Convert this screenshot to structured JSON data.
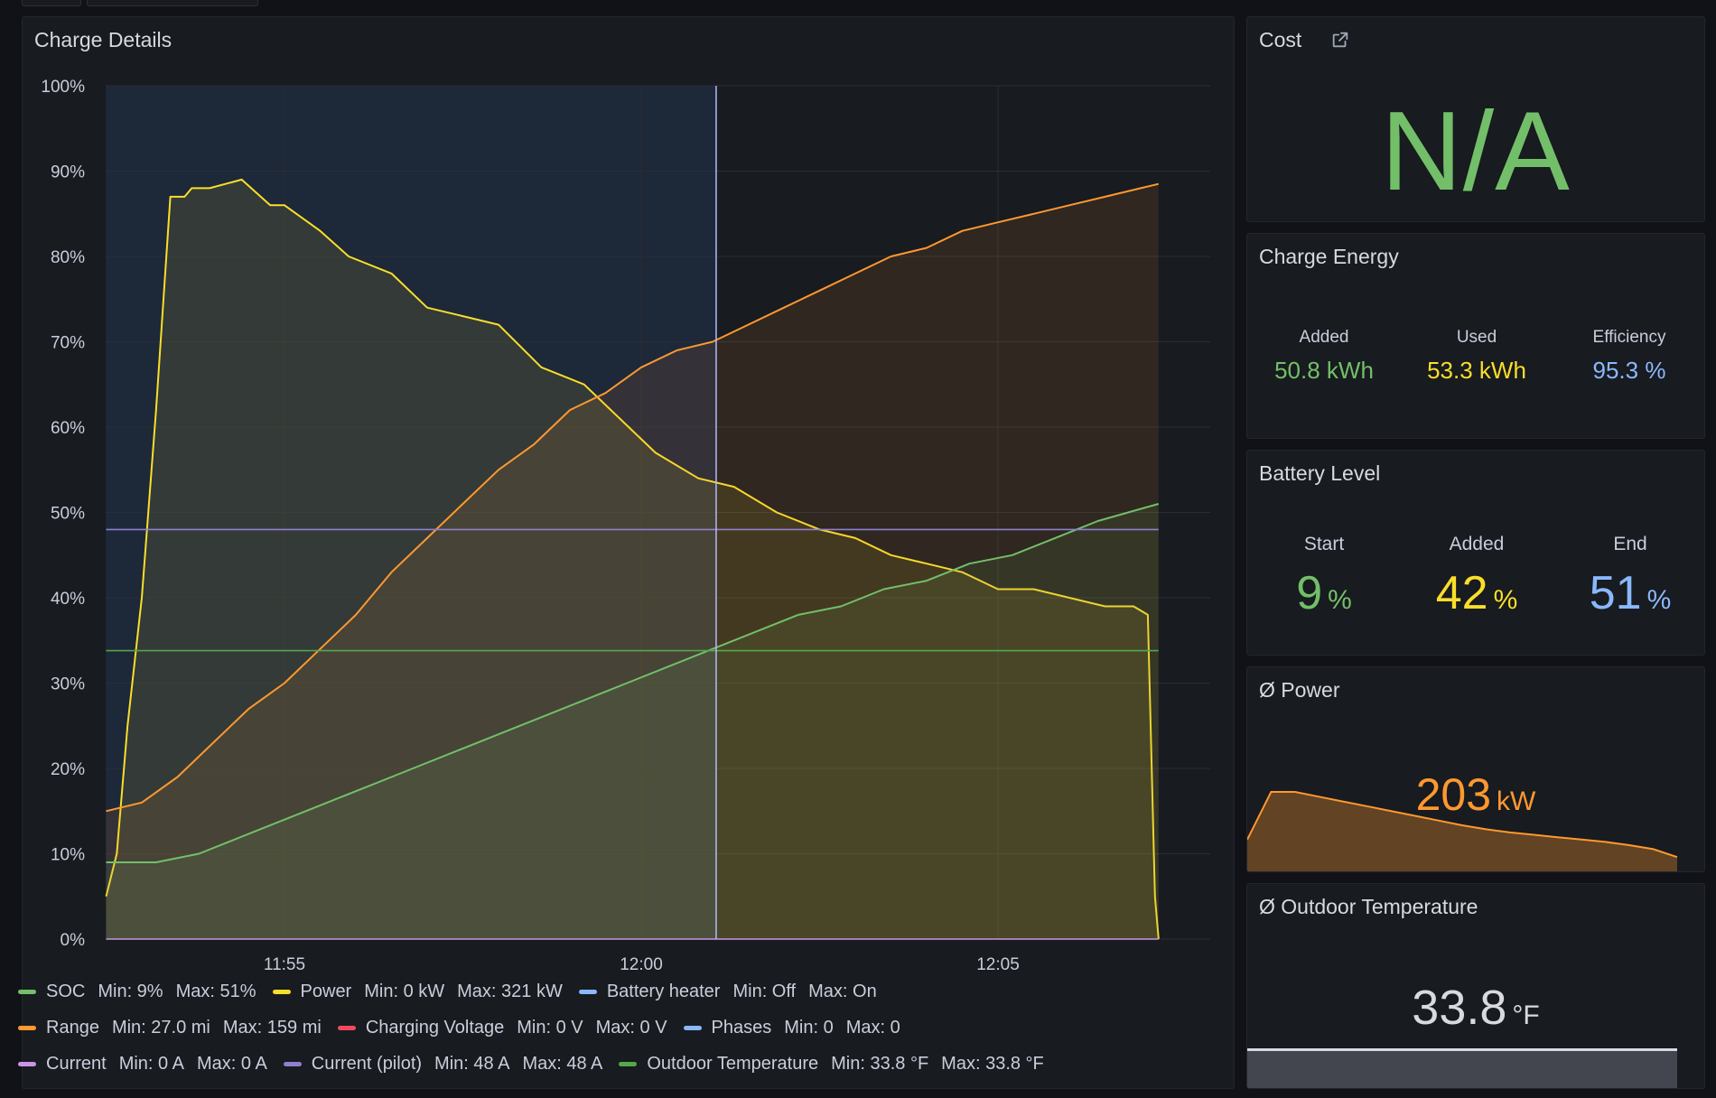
{
  "colors": {
    "green": "#73bf69",
    "yellow": "#fade2a",
    "blue": "#8ab8ff",
    "orange": "#ff9830",
    "red": "#f2495c",
    "purple": "#ca95e5",
    "lavender": "#8f7fd0",
    "darkgreen": "#56a64b",
    "highlight": "#b4b9ff"
  },
  "charge_details": {
    "title": "Charge Details",
    "chart_data": {
      "type": "line",
      "title": "Charge Details",
      "y_axis": {
        "ticks": [
          "0%",
          "10%",
          "20%",
          "30%",
          "40%",
          "50%",
          "60%",
          "70%",
          "80%",
          "90%",
          "100%"
        ],
        "range": [
          0,
          100
        ]
      },
      "x_axis": {
        "ticks": [
          "11:55",
          "12:00",
          "12:05"
        ],
        "range_minutes": [
          -2.5,
          12.8
        ]
      },
      "series": [
        {
          "name": "Power",
          "color": "yellow",
          "x": [
            -2.5,
            -2.35,
            -2.2,
            -2.0,
            -1.8,
            -1.6,
            -1.4,
            -1.3,
            -1.05,
            -0.6,
            -0.2,
            0.0,
            -0.2,
            0.0,
            0.5,
            0.9,
            1.5,
            2.0,
            2.5,
            3.0,
            3.6,
            4.2,
            4.7,
            5.2,
            5.8,
            6.3,
            6.9,
            7.5,
            8.0,
            8.5,
            9.0,
            9.5,
            10.0,
            10.5,
            11.0,
            11.5,
            11.9,
            12.1,
            12.2,
            12.25
          ],
          "y": [
            5,
            10,
            25,
            40,
            62,
            87,
            87,
            88,
            88,
            89,
            86,
            86,
            86,
            86,
            83,
            80,
            78,
            74,
            73,
            72,
            67,
            65,
            61,
            57,
            54,
            53,
            50,
            48,
            47,
            45,
            44,
            43,
            41,
            41,
            40,
            39,
            39,
            38,
            5,
            0
          ]
        },
        {
          "name": "Range",
          "color": "orange",
          "x": [
            -2.5,
            -2.0,
            -1.5,
            -1.0,
            -0.5,
            0.0,
            0.5,
            1.0,
            1.5,
            2.0,
            2.5,
            3.0,
            3.5,
            4.0,
            4.5,
            5.0,
            5.5,
            6.0,
            6.5,
            7.0,
            7.5,
            8.0,
            8.5,
            9.0,
            9.5,
            10.0,
            10.5,
            11.0,
            11.5,
            12.0,
            12.25
          ],
          "y": [
            15,
            16,
            19,
            23,
            27,
            30,
            34,
            38,
            43,
            47,
            51,
            55,
            58,
            62,
            64,
            67,
            69,
            70,
            72,
            74,
            76,
            78,
            80,
            81,
            83,
            84,
            85,
            86,
            87,
            88,
            88.5
          ]
        },
        {
          "name": "SOC",
          "color": "green",
          "x": [
            -2.5,
            -1.8,
            -1.2,
            -0.6,
            0.0,
            0.6,
            1.2,
            1.8,
            2.4,
            3.0,
            3.6,
            4.2,
            4.8,
            5.4,
            6.0,
            6.6,
            7.2,
            7.8,
            8.4,
            9.0,
            9.6,
            10.2,
            10.8,
            11.4,
            12.25
          ],
          "y": [
            9,
            9,
            10,
            12,
            14,
            16,
            18,
            20,
            22,
            24,
            26,
            28,
            30,
            32,
            34,
            36,
            38,
            39,
            41,
            42,
            44,
            45,
            47,
            49,
            51
          ]
        },
        {
          "name": "Current (pilot)",
          "color": "lavender",
          "x": [
            -2.5,
            12.25
          ],
          "y": [
            48,
            48
          ]
        },
        {
          "name": "Outdoor Temperature",
          "color": "darkgreen",
          "x": [
            -2.5,
            12.25
          ],
          "y": [
            33.8,
            33.8
          ]
        },
        {
          "name": "Current",
          "color": "purple",
          "x": [
            -2.5,
            12.25
          ],
          "y": [
            0,
            0
          ]
        }
      ],
      "hover": {
        "x_minutes": 6.05
      }
    }
  },
  "legend": [
    [
      {
        "name": "SOC",
        "color": "green",
        "min": "Min: 9%",
        "max": "Max: 51%"
      },
      {
        "name": "Power",
        "color": "yellow",
        "min": "Min: 0 kW",
        "max": "Max: 321 kW"
      },
      {
        "name": "Battery heater",
        "color": "blue",
        "min": "Min: Off",
        "max": "Max: On"
      }
    ],
    [
      {
        "name": "Range",
        "color": "orange",
        "min": "Min: 27.0 mi",
        "max": "Max: 159 mi"
      },
      {
        "name": "Charging Voltage",
        "color": "red",
        "min": "Min: 0 V",
        "max": "Max: 0 V"
      },
      {
        "name": "Phases",
        "color": "blue",
        "min": "Min: 0",
        "max": "Max: 0"
      }
    ],
    [
      {
        "name": "Current",
        "color": "purple",
        "min": "Min: 0 A",
        "max": "Max: 0 A"
      },
      {
        "name": "Current (pilot)",
        "color": "lavender",
        "min": "Min: 48 A",
        "max": "Max: 48 A"
      },
      {
        "name": "Outdoor Temperature",
        "color": "darkgreen",
        "min": "Min: 33.8 °F",
        "max": "Max: 33.8 °F"
      }
    ]
  ],
  "cost": {
    "title": "Cost",
    "value": "N/A",
    "icon": "external-link-icon"
  },
  "charge_energy": {
    "title": "Charge Energy",
    "added_label": "Added",
    "added_value": "50.8 kWh",
    "used_label": "Used",
    "used_value": "53.3 kWh",
    "eff_label": "Efficiency",
    "eff_value": "95.3 %"
  },
  "battery_level": {
    "title": "Battery Level",
    "start_label": "Start",
    "start_value": "9",
    "start_unit": "%",
    "added_label": "Added",
    "added_value": "42",
    "added_unit": "%",
    "end_label": "End",
    "end_value": "51",
    "end_unit": "%"
  },
  "power": {
    "title": "Ø Power",
    "value": "203",
    "unit": "kW",
    "sparkline": [
      0.4,
      1.0,
      1.0,
      0.94,
      0.88,
      0.82,
      0.76,
      0.7,
      0.64,
      0.58,
      0.53,
      0.49,
      0.46,
      0.43,
      0.4,
      0.37,
      0.33,
      0.28,
      0.18
    ]
  },
  "outdoor_temp": {
    "title": "Ø Outdoor Temperature",
    "value": "33.8",
    "unit": "°F"
  }
}
